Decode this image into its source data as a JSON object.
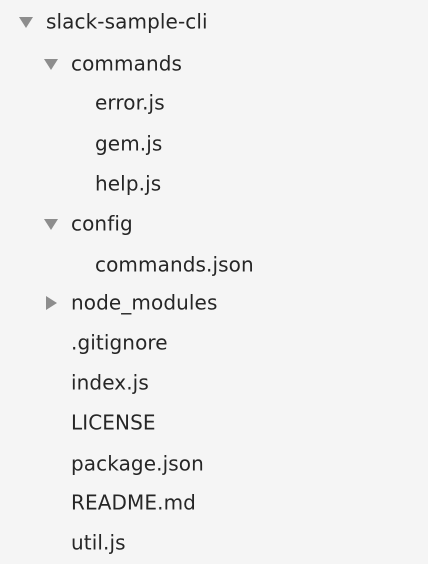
{
  "tree": {
    "root": {
      "label": "slack-sample-cli",
      "expanded": true,
      "toggle_icon": "triangle-down-icon"
    },
    "commands_folder": {
      "label": "commands",
      "expanded": true,
      "toggle_icon": "triangle-down-icon"
    },
    "commands_files": [
      {
        "label": "error.js"
      },
      {
        "label": "gem.js"
      },
      {
        "label": "help.js"
      }
    ],
    "config_folder": {
      "label": "config",
      "expanded": true,
      "toggle_icon": "triangle-down-icon"
    },
    "config_files": [
      {
        "label": "commands.json"
      }
    ],
    "node_modules_folder": {
      "label": "node_modules",
      "expanded": false,
      "toggle_icon": "triangle-right-icon"
    },
    "root_files": [
      {
        "label": ".gitignore"
      },
      {
        "label": "index.js"
      },
      {
        "label": "LICENSE"
      },
      {
        "label": "package.json"
      },
      {
        "label": "README.md"
      },
      {
        "label": "util.js"
      }
    ]
  },
  "colors": {
    "background": "#f5f5f5",
    "text": "#262626",
    "disclosure_triangle": "#8d8d8d"
  }
}
